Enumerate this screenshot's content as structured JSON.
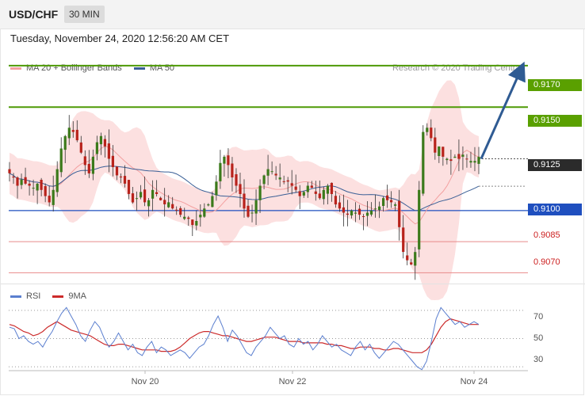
{
  "header": {
    "pair": "USD/CHF",
    "timeframe": "30 MIN"
  },
  "timestamp": "Tuesday, November 24, 2020 12:56:20 AM CET",
  "legend": {
    "ma20_label": "MA 20 + Bollinger Bands",
    "ma50_label": "MA 50",
    "credit": "Research © 2020 Trading Central",
    "colors": {
      "ma20": "#f08c8c",
      "ma50": "#3a5f96"
    }
  },
  "rsi_legend": {
    "rsi_label": "RSI",
    "ma_label": "9MA",
    "colors": {
      "rsi": "#5b7fcf",
      "ma": "#cc2b2b"
    }
  },
  "levels": [
    {
      "label": "0.9170",
      "style": "green"
    },
    {
      "label": "0.9150",
      "style": "green"
    },
    {
      "label": "0.9125",
      "style": "current"
    },
    {
      "label": "0.9100",
      "style": "blue"
    },
    {
      "label": "0.9085",
      "style": "red"
    },
    {
      "label": "0.9070",
      "style": "red"
    }
  ],
  "rsi_ticks": [
    "70",
    "50",
    "30"
  ],
  "x_ticks": [
    "Nov 20",
    "Nov 22",
    "Nov 24"
  ],
  "chart_data": {
    "type": "candlestick",
    "instrument": "USD/CHF",
    "timeframe": "30 MIN",
    "ylim": [
      0.9064,
      0.9178
    ],
    "levels": {
      "resistance": [
        0.917,
        0.915
      ],
      "current": 0.9125,
      "support": [
        0.91,
        0.9085,
        0.907
      ]
    },
    "close_series": [
      0.9118,
      0.9116,
      0.9112,
      0.9115,
      0.9113,
      0.9112,
      0.9111,
      0.9113,
      0.911,
      0.9107,
      0.9104,
      0.911,
      0.912,
      0.913,
      0.9136,
      0.914,
      0.9138,
      0.9134,
      0.9128,
      0.9122,
      0.9118,
      0.9126,
      0.9133,
      0.9136,
      0.9131,
      0.9125,
      0.9121,
      0.9117,
      0.9116,
      0.9113,
      0.9108,
      0.9104,
      0.9106,
      0.9109,
      0.9104,
      0.9105,
      0.911,
      0.9108,
      0.9105,
      0.9103,
      0.9104,
      0.9101,
      0.91,
      0.9098,
      0.9097,
      0.9096,
      0.9093,
      0.9095,
      0.9098,
      0.9101,
      0.9103,
      0.9107,
      0.9114,
      0.9123,
      0.9126,
      0.9122,
      0.9116,
      0.9112,
      0.9108,
      0.9101,
      0.9097,
      0.9099,
      0.9105,
      0.9112,
      0.9117,
      0.912,
      0.9119,
      0.9117,
      0.9116,
      0.9114,
      0.9114,
      0.9112,
      0.911,
      0.9107,
      0.9109,
      0.9112,
      0.9111,
      0.9108,
      0.9106,
      0.911,
      0.9112,
      0.9108,
      0.9103,
      0.9101,
      0.9099,
      0.9098,
      0.91,
      0.9099,
      0.9098,
      0.9097,
      0.9099,
      0.91,
      0.9101,
      0.9102,
      0.9106,
      0.9105,
      0.9104,
      0.9103,
      0.9092,
      0.908,
      0.9076,
      0.9074,
      0.908,
      0.911,
      0.9138,
      0.914,
      0.9135,
      0.9128,
      0.9131,
      0.9126,
      0.9125,
      0.9124,
      0.9126,
      0.9125,
      0.9127,
      0.9125,
      0.9124,
      0.9124,
      0.9126
    ],
    "rsi": {
      "name": "RSI",
      "values": [
        58,
        57,
        50,
        52,
        48,
        46,
        48,
        44,
        50,
        55,
        62,
        68,
        72,
        66,
        60,
        52,
        48,
        56,
        62,
        58,
        50,
        44,
        48,
        54,
        48,
        42,
        46,
        40,
        38,
        44,
        48,
        40,
        44,
        42,
        38,
        40,
        42,
        40,
        36,
        40,
        44,
        46,
        52,
        60,
        66,
        58,
        48,
        56,
        52,
        46,
        40,
        38,
        44,
        48,
        52,
        58,
        54,
        50,
        52,
        46,
        44,
        50,
        46,
        48,
        42,
        46,
        52,
        48,
        44,
        46,
        42,
        40,
        38,
        44,
        48,
        42,
        46,
        40,
        36,
        40,
        44,
        48,
        46,
        42,
        38,
        34,
        30,
        28,
        34,
        48,
        64,
        72,
        68,
        64,
        60,
        62,
        58,
        60,
        62,
        60
      ]
    },
    "rsi_ma": {
      "name": "9MA",
      "values": [
        60,
        59,
        57,
        55,
        54,
        52,
        53,
        55,
        58,
        60,
        62,
        60,
        58,
        56,
        55,
        54,
        53,
        52,
        50,
        48,
        46,
        45,
        45,
        46,
        46,
        45,
        44,
        43,
        42,
        42,
        42,
        42,
        41,
        41,
        41,
        42,
        44,
        47,
        50,
        52,
        54,
        55,
        55,
        54,
        53,
        52,
        52,
        51,
        50,
        49,
        48,
        48,
        49,
        50,
        51,
        51,
        51,
        50,
        49,
        48,
        48,
        48,
        47,
        47,
        47,
        47,
        47,
        46,
        46,
        45,
        45,
        44,
        43,
        43,
        44,
        44,
        44,
        43,
        43,
        42,
        42,
        43,
        43,
        42,
        41,
        40,
        40,
        40,
        42,
        46,
        52,
        58,
        62,
        64,
        63,
        62,
        61,
        60,
        60,
        60
      ]
    },
    "rsi_ylim": [
      20,
      80
    ],
    "rsi_levels": [
      70,
      50,
      30
    ],
    "x_ticks": [
      "Nov 20",
      "Nov 22",
      "Nov 24"
    ],
    "forecast_arrow": {
      "from": 0.9125,
      "to": 0.917
    }
  }
}
